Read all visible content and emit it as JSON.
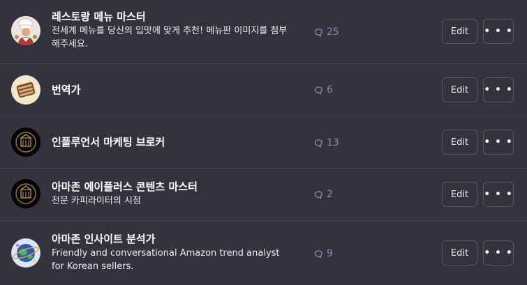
{
  "gpts": [
    {
      "title": "레스토랑 메뉴 마스터",
      "description": "전세계 메뉴를 당신의 입맛에 맞게 추천! 메뉴판 이미지를 첨부해주세요.",
      "conversations": "25",
      "icon": "chef-icon",
      "edit_label": "Edit"
    },
    {
      "title": "번역가",
      "description": "",
      "conversations": "6",
      "icon": "scroll-icon",
      "edit_label": "Edit"
    },
    {
      "title": "인플루언서 마케팅 브로커",
      "description": "",
      "conversations": "13",
      "icon": "gold-crest-icon",
      "edit_label": "Edit"
    },
    {
      "title": "아마존 에이플러스 콘텐츠 마스터",
      "description": "전문 카피라이터의 시점",
      "conversations": "2",
      "icon": "gold-crest-icon",
      "edit_label": "Edit"
    },
    {
      "title": "아마존 인사이트 분석가",
      "description": "Friendly and conversational Amazon trend analyst for Korean sellers.",
      "conversations": "9",
      "icon": "globe-icon",
      "edit_label": "Edit"
    }
  ],
  "more_button_glyph": "• • •",
  "colors": {
    "background": "#333340",
    "divider": "#424250",
    "muted_text": "#8e8ea0",
    "button_border": "#565869"
  }
}
